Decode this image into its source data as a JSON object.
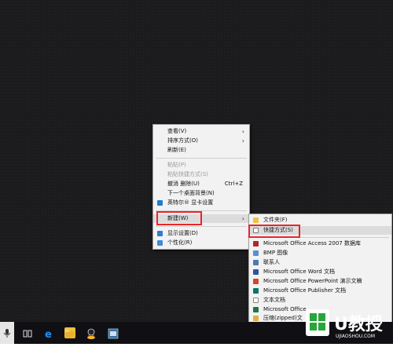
{
  "colors": {
    "highlight_box": "#e8262b",
    "menu_bg": "#f2f2f2"
  },
  "context_menu": {
    "items": [
      {
        "label": "查看(V)",
        "arrow": "›"
      },
      {
        "label": "排序方式(O)",
        "arrow": "›"
      },
      {
        "label": "刷新(E)"
      },
      {
        "label": "粘贴(P)"
      },
      {
        "label": "粘贴快捷方式(S)"
      },
      {
        "label": "撤消 删除(U)",
        "shortcut": "Ctrl+Z"
      },
      {
        "label": "下一个桌面背景(N)"
      },
      {
        "label": "英特尔® 显卡设置"
      },
      {
        "label": "新建(W)",
        "arrow": "›"
      },
      {
        "label": "显示设置(D)"
      },
      {
        "label": "个性化(R)"
      }
    ]
  },
  "submenu": {
    "items": [
      {
        "label": "文件夹(F)"
      },
      {
        "label": "快捷方式(S)"
      },
      {
        "label": "Microsoft Office Access 2007 数据库"
      },
      {
        "label": "BMP 图像"
      },
      {
        "label": "联系人"
      },
      {
        "label": "Microsoft Office Word 文档"
      },
      {
        "label": "Microsoft Office PowerPoint 演示文稿"
      },
      {
        "label": "Microsoft Office Publisher 文档"
      },
      {
        "label": "文本文档"
      },
      {
        "label": "Microsoft Office"
      },
      {
        "label": "压缩(zipped)文"
      }
    ]
  },
  "taskbar": {
    "icons": [
      "mic-icon",
      "task-view-icon",
      "edge-icon",
      "file-explorer-icon",
      "app-icon",
      "app-window-icon"
    ]
  },
  "watermark": {
    "main": "U教授",
    "url": "UJIAOSHOU.COM"
  }
}
